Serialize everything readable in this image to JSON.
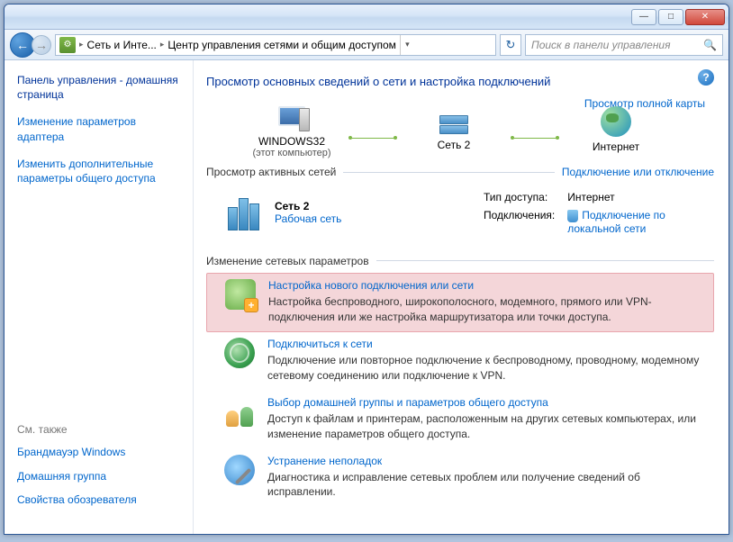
{
  "titlebar": {
    "minimize": "—",
    "maximize": "□",
    "close": "✕"
  },
  "nav": {
    "crumb1": "Сеть и Инте...",
    "crumb2": "Центр управления сетями и общим доступом",
    "search_placeholder": "Поиск в панели управления"
  },
  "sidebar": {
    "home": "Панель управления - домашняя страница",
    "link1": "Изменение параметров адаптера",
    "link2": "Изменить дополнительные параметры общего доступа",
    "see_also": "См. также",
    "footer1": "Брандмауэр Windows",
    "footer2": "Домашняя группа",
    "footer3": "Свойства обозревателя"
  },
  "main": {
    "heading": "Просмотр основных сведений о сети и настройка подключений",
    "map_link": "Просмотр полной карты",
    "map": {
      "node1": "WINDOWS32",
      "node1_sub": "(этот компьютер)",
      "node2": "Сеть  2",
      "node3": "Интернет"
    },
    "active_label": "Просмотр активных сетей",
    "active_link": "Подключение или отключение",
    "active": {
      "name": "Сеть  2",
      "type": "Рабочая сеть",
      "access_label": "Тип доступа:",
      "access_value": "Интернет",
      "conn_label": "Подключения:",
      "conn_value": "Подключение по локальной сети"
    },
    "change_label": "Изменение сетевых параметров",
    "tasks": [
      {
        "title": "Настройка нового подключения или сети",
        "desc": "Настройка беспроводного, широкополосного, модемного, прямого или VPN-подключения или же настройка маршрутизатора или точки доступа."
      },
      {
        "title": "Подключиться к сети",
        "desc": "Подключение или повторное подключение к беспроводному, проводному, модемному сетевому соединению или подключение к VPN."
      },
      {
        "title": "Выбор домашней группы и параметров общего доступа",
        "desc": "Доступ к файлам и принтерам, расположенным на других сетевых компьютерах, или изменение параметров общего доступа."
      },
      {
        "title": "Устранение неполадок",
        "desc": "Диагностика и исправление сетевых проблем или получение сведений об исправлении."
      }
    ]
  }
}
